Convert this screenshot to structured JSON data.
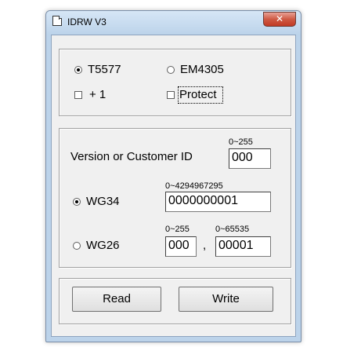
{
  "window": {
    "title": "IDRW V3",
    "close_glyph": "✕"
  },
  "chip_group": {
    "radio_t5577": {
      "label": "T5577",
      "checked": true
    },
    "radio_em4305": {
      "label": "EM4305",
      "checked": false
    },
    "check_plus1": {
      "label": "+ 1",
      "checked": false
    },
    "check_protect": {
      "label": "Protect",
      "checked": false
    }
  },
  "id_group": {
    "version_label": "Version or Customer ID",
    "version_range": "0~255",
    "version_value": "000",
    "wg34": {
      "label": "WG34",
      "checked": true,
      "range": "0~4294967295",
      "value": "0000000001"
    },
    "wg26": {
      "label": "WG26",
      "checked": false,
      "range1": "0~255",
      "value1": "000",
      "separator": ",",
      "range2": "0~65535",
      "value2": "00001"
    }
  },
  "buttons": {
    "read": "Read",
    "write": "Write"
  }
}
